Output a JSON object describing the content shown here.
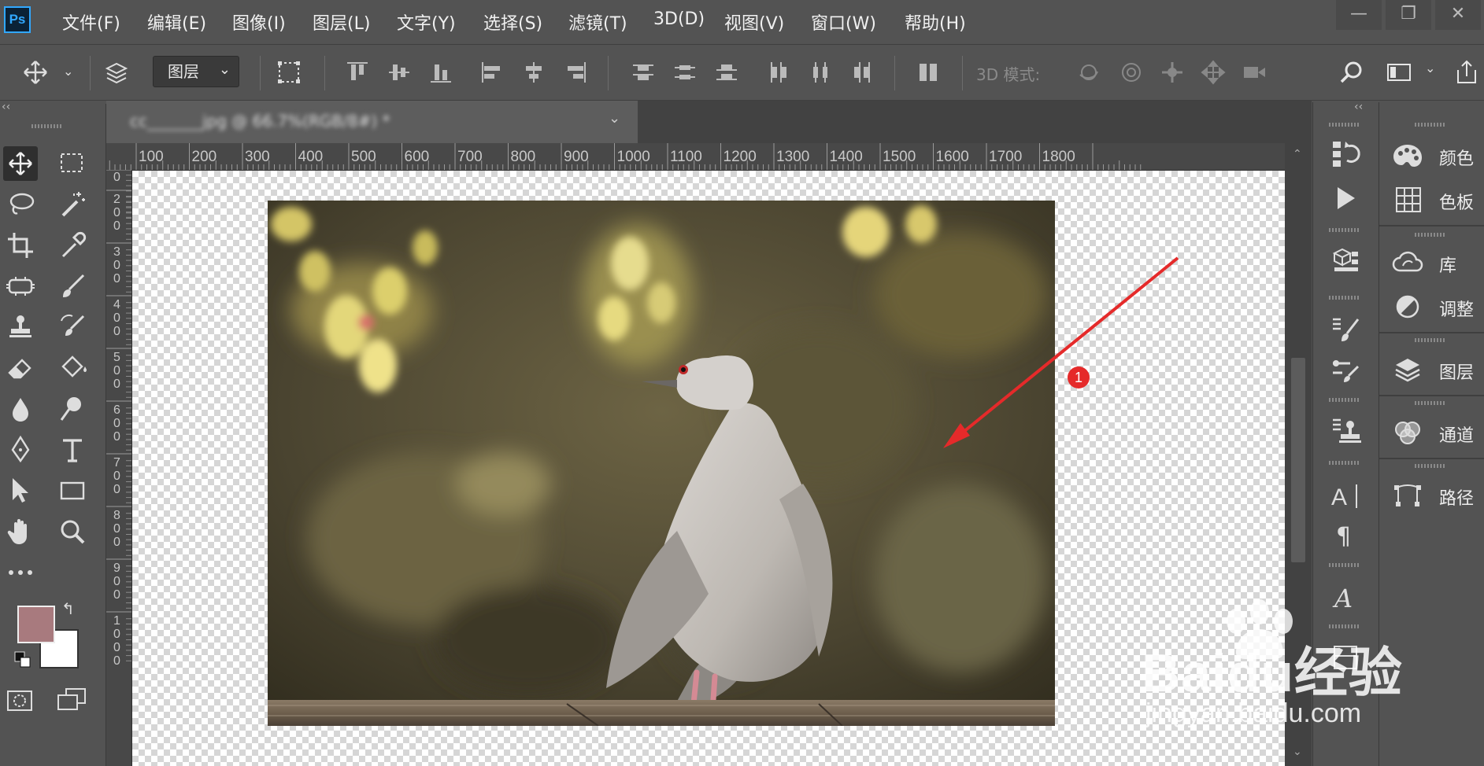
{
  "app": {
    "logo": "Ps"
  },
  "menu": [
    "文件(F)",
    "编辑(E)",
    "图像(I)",
    "图层(L)",
    "文字(Y)",
    "选择(S)",
    "滤镜(T)",
    "3D(D)",
    "视图(V)",
    "窗口(W)",
    "帮助(H)"
  ],
  "options_bar": {
    "auto_select_target": "图层",
    "mode_3d_label": "3D 模式:"
  },
  "document": {
    "tab_title": "cc_______jpg @ 66.7%(RGB/8#) *",
    "annotation_number": "1"
  },
  "ruler": {
    "horizontal": [
      "100",
      "200",
      "300",
      "400",
      "500",
      "600",
      "700",
      "800",
      "900",
      "1000",
      "1100",
      "1200",
      "1300",
      "1400",
      "1500",
      "1600",
      "1700",
      "1800"
    ],
    "vertical": [
      "0",
      "200",
      "300",
      "400",
      "500",
      "600",
      "700",
      "800",
      "900",
      "1000"
    ]
  },
  "panels": [
    {
      "label": "颜色",
      "icon": "palette-icon"
    },
    {
      "label": "色板",
      "icon": "swatches-grid-icon"
    },
    {
      "label": "库",
      "icon": "libraries-cloud-icon"
    },
    {
      "label": "调整",
      "icon": "adjustments-icon"
    },
    {
      "label": "图层",
      "icon": "layers-icon"
    },
    {
      "label": "通道",
      "icon": "channels-icon"
    },
    {
      "label": "路径",
      "icon": "paths-icon"
    }
  ],
  "colors": {
    "foreground": "#a87a7e",
    "background": "#ffffff",
    "accent": "#31a8ff",
    "arrow": "#e52a2a"
  },
  "watermark": {
    "brand": "Baidu经验",
    "url": "jingyan.baidu.com"
  }
}
